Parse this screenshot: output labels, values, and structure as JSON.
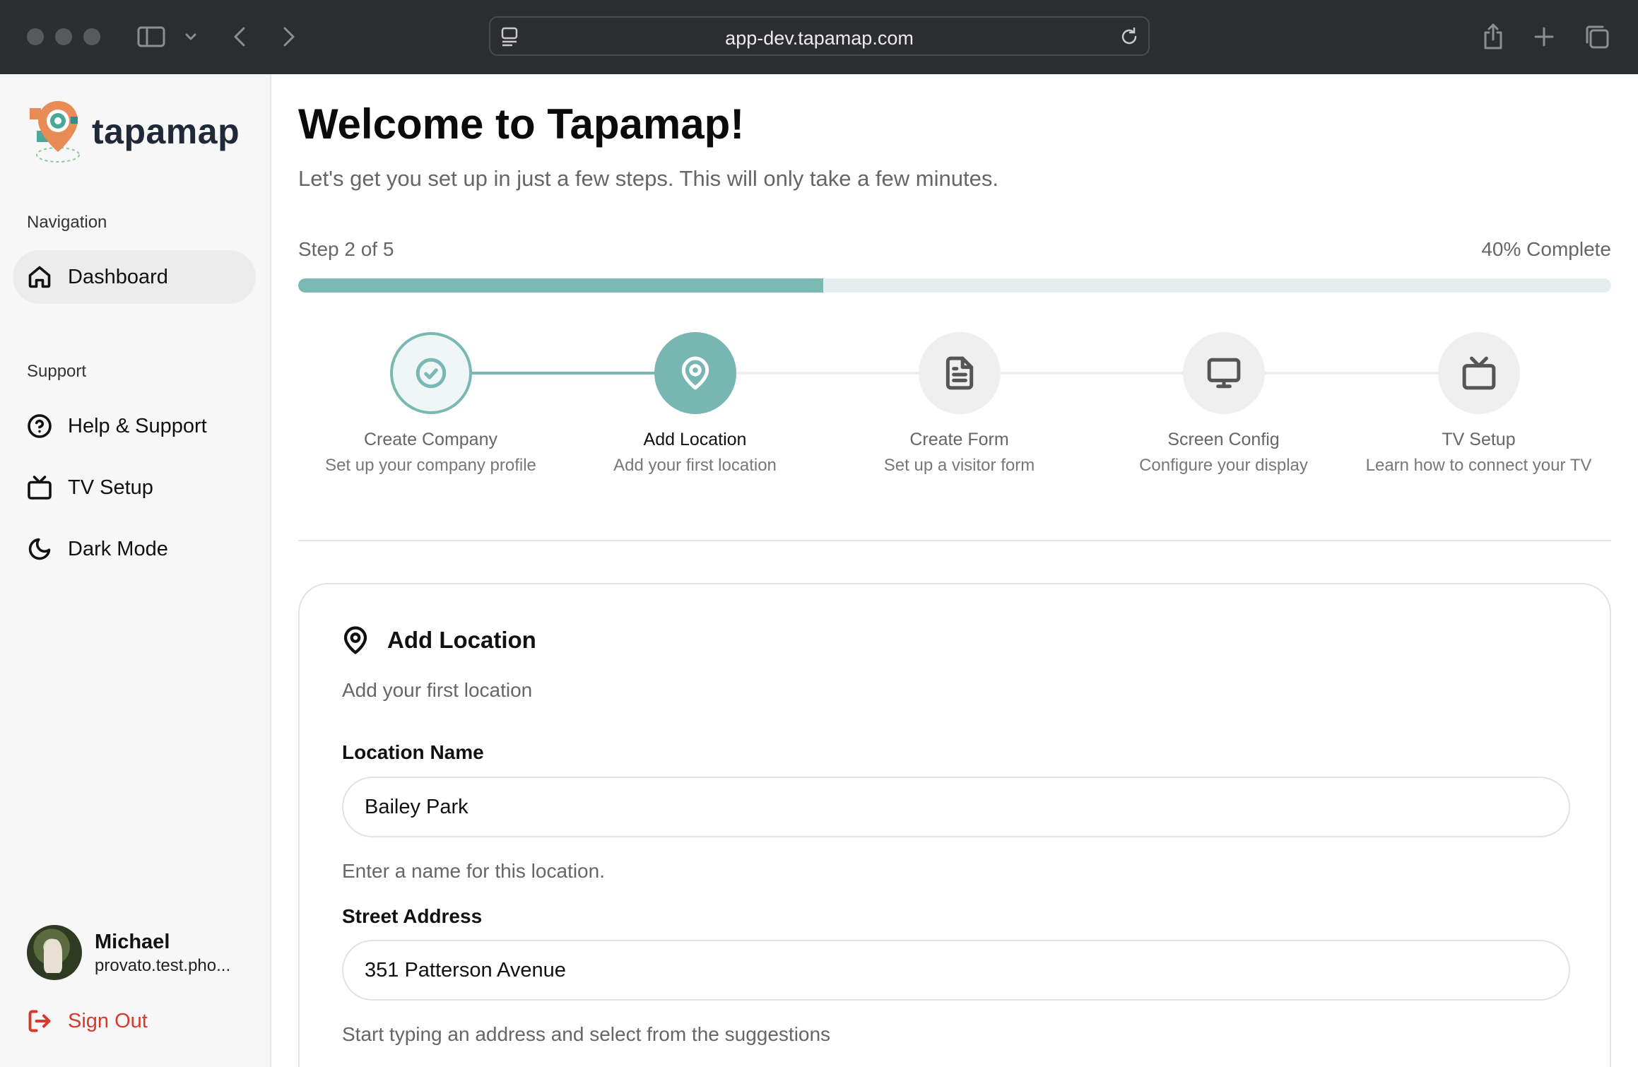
{
  "browser": {
    "url": "app-dev.tapamap.com"
  },
  "sidebar": {
    "logo_text": "tapamap",
    "nav_section_title": "Navigation",
    "nav_items": [
      {
        "label": "Dashboard",
        "icon": "home-icon",
        "active": true
      }
    ],
    "support_section_title": "Support",
    "support_items": [
      {
        "label": "Help & Support",
        "icon": "help-circle-icon"
      },
      {
        "label": "TV Setup",
        "icon": "tv-icon"
      },
      {
        "label": "Dark Mode",
        "icon": "moon-icon"
      }
    ],
    "user": {
      "name": "Michael",
      "email": "provato.test.pho..."
    },
    "sign_out_label": "Sign Out"
  },
  "main": {
    "title": "Welcome to Tapamap!",
    "subtitle": "Let's get you set up in just a few steps. This will only take a few minutes.",
    "step_label": "Step 2 of 5",
    "percent_label": "40% Complete",
    "progress_fraction": 0.4,
    "steps": [
      {
        "title": "Create Company",
        "description": "Set up your company profile",
        "state": "done",
        "icon": "check-circle-icon"
      },
      {
        "title": "Add Location",
        "description": "Add your first location",
        "state": "active",
        "icon": "map-pin-icon"
      },
      {
        "title": "Create Form",
        "description": "Set up a visitor form",
        "state": "pending",
        "icon": "document-icon"
      },
      {
        "title": "Screen Config",
        "description": "Configure your display",
        "state": "pending",
        "icon": "monitor-icon"
      },
      {
        "title": "TV Setup",
        "description": "Learn how to connect your TV",
        "state": "pending",
        "icon": "tv-icon"
      }
    ],
    "card": {
      "title": "Add Location",
      "subtitle": "Add your first location",
      "fields": [
        {
          "label": "Location Name",
          "value": "Bailey Park",
          "help": "Enter a name for this location."
        },
        {
          "label": "Street Address",
          "value": "351 Patterson Avenue",
          "help": "Start typing an address and select from the suggestions"
        }
      ]
    }
  },
  "colors": {
    "accent_teal": "#7ab8b4",
    "sign_out_red": "#d63a2f",
    "chrome_bg": "#2c2d30"
  }
}
